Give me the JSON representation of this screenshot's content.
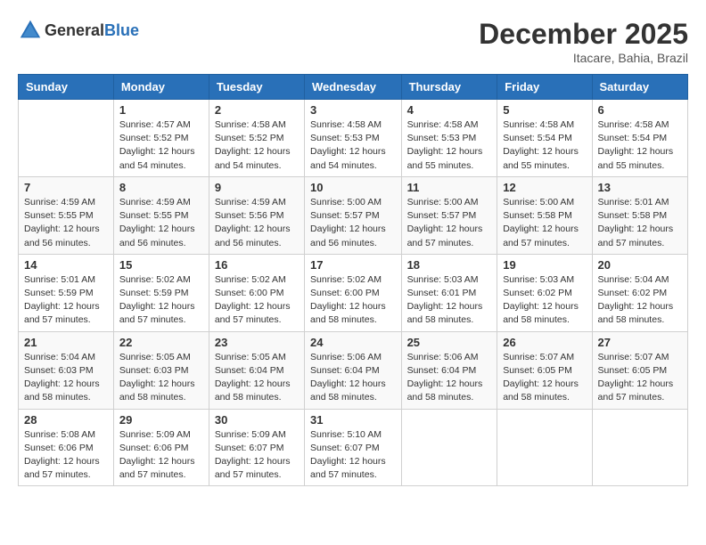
{
  "header": {
    "logo_general": "General",
    "logo_blue": "Blue",
    "month_year": "December 2025",
    "location": "Itacare, Bahia, Brazil"
  },
  "calendar": {
    "days_of_week": [
      "Sunday",
      "Monday",
      "Tuesday",
      "Wednesday",
      "Thursday",
      "Friday",
      "Saturday"
    ],
    "weeks": [
      [
        {
          "day": "",
          "info": ""
        },
        {
          "day": "1",
          "info": "Sunrise: 4:57 AM\nSunset: 5:52 PM\nDaylight: 12 hours\nand 54 minutes."
        },
        {
          "day": "2",
          "info": "Sunrise: 4:58 AM\nSunset: 5:52 PM\nDaylight: 12 hours\nand 54 minutes."
        },
        {
          "day": "3",
          "info": "Sunrise: 4:58 AM\nSunset: 5:53 PM\nDaylight: 12 hours\nand 54 minutes."
        },
        {
          "day": "4",
          "info": "Sunrise: 4:58 AM\nSunset: 5:53 PM\nDaylight: 12 hours\nand 55 minutes."
        },
        {
          "day": "5",
          "info": "Sunrise: 4:58 AM\nSunset: 5:54 PM\nDaylight: 12 hours\nand 55 minutes."
        },
        {
          "day": "6",
          "info": "Sunrise: 4:58 AM\nSunset: 5:54 PM\nDaylight: 12 hours\nand 55 minutes."
        }
      ],
      [
        {
          "day": "7",
          "info": "Sunrise: 4:59 AM\nSunset: 5:55 PM\nDaylight: 12 hours\nand 56 minutes."
        },
        {
          "day": "8",
          "info": "Sunrise: 4:59 AM\nSunset: 5:55 PM\nDaylight: 12 hours\nand 56 minutes."
        },
        {
          "day": "9",
          "info": "Sunrise: 4:59 AM\nSunset: 5:56 PM\nDaylight: 12 hours\nand 56 minutes."
        },
        {
          "day": "10",
          "info": "Sunrise: 5:00 AM\nSunset: 5:57 PM\nDaylight: 12 hours\nand 56 minutes."
        },
        {
          "day": "11",
          "info": "Sunrise: 5:00 AM\nSunset: 5:57 PM\nDaylight: 12 hours\nand 57 minutes."
        },
        {
          "day": "12",
          "info": "Sunrise: 5:00 AM\nSunset: 5:58 PM\nDaylight: 12 hours\nand 57 minutes."
        },
        {
          "day": "13",
          "info": "Sunrise: 5:01 AM\nSunset: 5:58 PM\nDaylight: 12 hours\nand 57 minutes."
        }
      ],
      [
        {
          "day": "14",
          "info": "Sunrise: 5:01 AM\nSunset: 5:59 PM\nDaylight: 12 hours\nand 57 minutes."
        },
        {
          "day": "15",
          "info": "Sunrise: 5:02 AM\nSunset: 5:59 PM\nDaylight: 12 hours\nand 57 minutes."
        },
        {
          "day": "16",
          "info": "Sunrise: 5:02 AM\nSunset: 6:00 PM\nDaylight: 12 hours\nand 57 minutes."
        },
        {
          "day": "17",
          "info": "Sunrise: 5:02 AM\nSunset: 6:00 PM\nDaylight: 12 hours\nand 58 minutes."
        },
        {
          "day": "18",
          "info": "Sunrise: 5:03 AM\nSunset: 6:01 PM\nDaylight: 12 hours\nand 58 minutes."
        },
        {
          "day": "19",
          "info": "Sunrise: 5:03 AM\nSunset: 6:02 PM\nDaylight: 12 hours\nand 58 minutes."
        },
        {
          "day": "20",
          "info": "Sunrise: 5:04 AM\nSunset: 6:02 PM\nDaylight: 12 hours\nand 58 minutes."
        }
      ],
      [
        {
          "day": "21",
          "info": "Sunrise: 5:04 AM\nSunset: 6:03 PM\nDaylight: 12 hours\nand 58 minutes."
        },
        {
          "day": "22",
          "info": "Sunrise: 5:05 AM\nSunset: 6:03 PM\nDaylight: 12 hours\nand 58 minutes."
        },
        {
          "day": "23",
          "info": "Sunrise: 5:05 AM\nSunset: 6:04 PM\nDaylight: 12 hours\nand 58 minutes."
        },
        {
          "day": "24",
          "info": "Sunrise: 5:06 AM\nSunset: 6:04 PM\nDaylight: 12 hours\nand 58 minutes."
        },
        {
          "day": "25",
          "info": "Sunrise: 5:06 AM\nSunset: 6:04 PM\nDaylight: 12 hours\nand 58 minutes."
        },
        {
          "day": "26",
          "info": "Sunrise: 5:07 AM\nSunset: 6:05 PM\nDaylight: 12 hours\nand 58 minutes."
        },
        {
          "day": "27",
          "info": "Sunrise: 5:07 AM\nSunset: 6:05 PM\nDaylight: 12 hours\nand 57 minutes."
        }
      ],
      [
        {
          "day": "28",
          "info": "Sunrise: 5:08 AM\nSunset: 6:06 PM\nDaylight: 12 hours\nand 57 minutes."
        },
        {
          "day": "29",
          "info": "Sunrise: 5:09 AM\nSunset: 6:06 PM\nDaylight: 12 hours\nand 57 minutes."
        },
        {
          "day": "30",
          "info": "Sunrise: 5:09 AM\nSunset: 6:07 PM\nDaylight: 12 hours\nand 57 minutes."
        },
        {
          "day": "31",
          "info": "Sunrise: 5:10 AM\nSunset: 6:07 PM\nDaylight: 12 hours\nand 57 minutes."
        },
        {
          "day": "",
          "info": ""
        },
        {
          "day": "",
          "info": ""
        },
        {
          "day": "",
          "info": ""
        }
      ]
    ]
  }
}
